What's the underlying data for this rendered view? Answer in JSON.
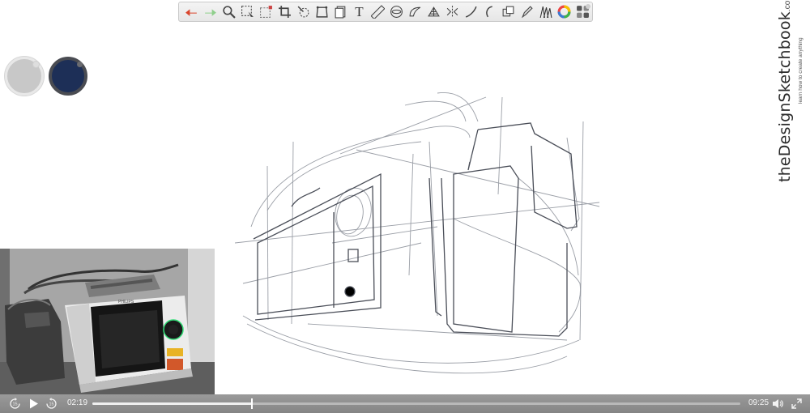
{
  "toolbar": {
    "tools": [
      {
        "name": "undo-icon",
        "color": "#d9442b"
      },
      {
        "name": "redo-icon",
        "color": "#8fcf8c"
      },
      {
        "name": "zoom-icon"
      },
      {
        "name": "select-icon"
      },
      {
        "name": "lasso-select-icon"
      },
      {
        "name": "crop-icon"
      },
      {
        "name": "transform-icon"
      },
      {
        "name": "perspective-icon"
      },
      {
        "name": "layers-icon"
      },
      {
        "name": "text-icon"
      },
      {
        "name": "ruler-icon"
      },
      {
        "name": "ellipse-guide-icon"
      },
      {
        "name": "french-curve-icon"
      },
      {
        "name": "perspective-grid-icon"
      },
      {
        "name": "symmetry-icon"
      },
      {
        "name": "steady-stroke-icon"
      },
      {
        "name": "predictive-stroke-icon"
      },
      {
        "name": "copic-color-icon"
      },
      {
        "name": "brush-icon"
      },
      {
        "name": "brush-library-icon"
      },
      {
        "name": "color-wheel-icon"
      },
      {
        "name": "palette-icon"
      }
    ],
    "text_tool_glyph": "T"
  },
  "swatches": [
    {
      "name": "light-gray",
      "color": "#c8c8c8"
    },
    {
      "name": "navy",
      "color": "#1d2f57"
    }
  ],
  "brand": {
    "name": "theDesignSketchbook",
    "suffix": ".com",
    "tagline": "learn how to create anything"
  },
  "webcam": {
    "device_label": "PHILIPS"
  },
  "player": {
    "current_time": "02:19",
    "total_time": "09:25",
    "progress": 0.246,
    "skip_back_label": "15",
    "skip_forward_label": "15"
  }
}
